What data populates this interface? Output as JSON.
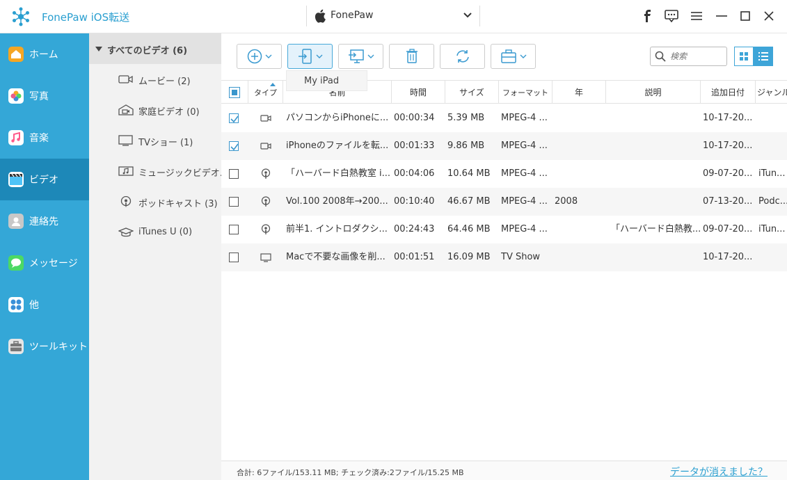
{
  "app": {
    "title": "FonePaw iOS転送",
    "device": "FonePaw"
  },
  "nav": [
    {
      "label": "ホーム",
      "icon": "home-icon",
      "color": "#f5a623"
    },
    {
      "label": "写真",
      "icon": "photos-icon",
      "color": "#e85d8a"
    },
    {
      "label": "音楽",
      "icon": "music-icon",
      "color": "#ff6b9a"
    },
    {
      "label": "ビデオ",
      "icon": "video-icon",
      "color": "#4fc3f7"
    },
    {
      "label": "連絡先",
      "icon": "contacts-icon",
      "color": "#b0b0b0"
    },
    {
      "label": "メッセージ",
      "icon": "messages-icon",
      "color": "#4cd964"
    },
    {
      "label": "他",
      "icon": "other-icon",
      "color": "#3a8fd8"
    },
    {
      "label": "ツールキット",
      "icon": "toolkit-icon",
      "color": "#e0e0e0"
    }
  ],
  "categories": {
    "header": "すべてのビデオ (6)",
    "items": [
      {
        "label": "ムービー (2)",
        "icon": "movie-icon"
      },
      {
        "label": "家庭ビデオ (0)",
        "icon": "home-video-icon"
      },
      {
        "label": "TVショー (1)",
        "icon": "tv-icon"
      },
      {
        "label": "ミュージックビデオ...",
        "icon": "music-video-icon"
      },
      {
        "label": "ポッドキャスト (3)",
        "icon": "podcast-icon"
      },
      {
        "label": "iTunes U (0)",
        "icon": "itunes-u-icon"
      }
    ]
  },
  "toolbar": {
    "tooltip": "My iPad",
    "search_placeholder": "検索"
  },
  "table": {
    "columns": [
      "タイプ",
      "名前",
      "時間",
      "サイズ",
      "フォーマット",
      "年",
      "説明",
      "追加日付",
      "ジャンル"
    ],
    "rows": [
      {
        "checked": true,
        "type": "video",
        "name": "パソコンからiPhoneに...",
        "time": "00:00:34",
        "size": "5.39 MB",
        "format": "MPEG-4 ...",
        "year": "",
        "desc": "",
        "date": "10-17-20...",
        "genre": ""
      },
      {
        "checked": true,
        "type": "video",
        "name": "iPhoneのファイルを転...",
        "time": "00:01:33",
        "size": "9.86 MB",
        "format": "MPEG-4 ...",
        "year": "",
        "desc": "",
        "date": "10-17-20...",
        "genre": ""
      },
      {
        "checked": false,
        "type": "podcast",
        "name": "「ハーバード白熱教室 i...",
        "time": "00:04:06",
        "size": "10.64 MB",
        "format": "MPEG-4 ...",
        "year": "",
        "desc": "",
        "date": "09-07-20...",
        "genre": "iTun..."
      },
      {
        "checked": false,
        "type": "podcast",
        "name": "Vol.100 2008年→200...",
        "time": "00:10:40",
        "size": "46.67 MB",
        "format": "MPEG-4 ...",
        "year": "2008",
        "desc": "",
        "date": "07-13-20...",
        "genre": "Podc..."
      },
      {
        "checked": false,
        "type": "podcast",
        "name": "前半1. イントロダクシ...",
        "time": "00:24:43",
        "size": "64.46 MB",
        "format": "MPEG-4 ...",
        "year": "",
        "desc": "「ハーバード白熱教...",
        "date": "09-07-20...",
        "genre": "iTun..."
      },
      {
        "checked": false,
        "type": "tv",
        "name": "Macで不要な画像を削...",
        "time": "00:01:51",
        "size": "16.09 MB",
        "format": "TV Show",
        "year": "",
        "desc": "",
        "date": "10-17-20...",
        "genre": ""
      }
    ]
  },
  "status": {
    "summary": "合計: 6ファイル/153.11 MB; チェック済み:2ファイル/15.25 MB",
    "link": "データが消えました？"
  },
  "colors": {
    "accent": "#34a7d7",
    "nav_active": "#1d88b8",
    "brand_text": "#2a9fd0"
  }
}
